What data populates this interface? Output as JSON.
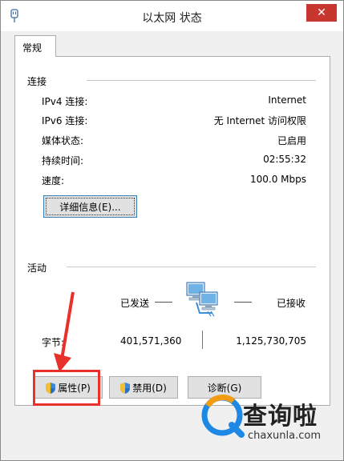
{
  "window": {
    "title": "以太网 状态",
    "close_glyph": "✕"
  },
  "tabs": [
    {
      "label": "常规"
    }
  ],
  "connection": {
    "group_label": "连接",
    "rows": [
      {
        "label": "IPv4 连接:",
        "value": "Internet"
      },
      {
        "label": "IPv6 连接:",
        "value": "无 Internet 访问权限"
      },
      {
        "label": "媒体状态:",
        "value": "已启用"
      },
      {
        "label": "持续时间:",
        "value": "02:55:32"
      },
      {
        "label": "速度:",
        "value": "100.0 Mbps"
      }
    ],
    "details_button": "详细信息(E)..."
  },
  "activity": {
    "group_label": "活动",
    "sent_label": "已发送",
    "received_label": "已接收",
    "bytes_label": "字节:",
    "bytes_sent": "401,571,360",
    "bytes_received": "1,125,730,705",
    "icon": "network-computers-icon"
  },
  "buttons": {
    "properties": "属性(P)",
    "disable": "禁用(D)",
    "diagnose": "诊断(G)"
  },
  "watermark": {
    "text": "查询啦",
    "url": "chaxunla.com"
  },
  "colors": {
    "annotation_red": "#e8312a",
    "close_red": "#c7372f",
    "watermark_blue": "#1e88e5",
    "watermark_orange": "#f39c12"
  }
}
